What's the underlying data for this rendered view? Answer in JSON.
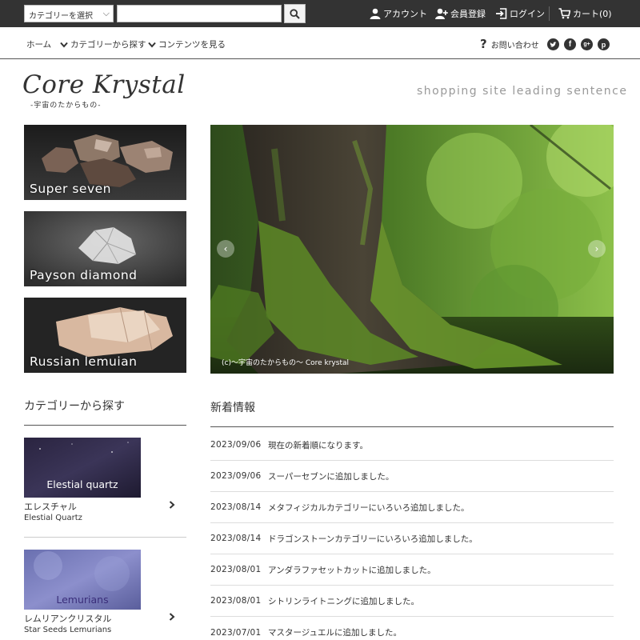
{
  "topbar": {
    "category_select": "カテゴリーを選択",
    "search_placeholder": "",
    "account": "アカウント",
    "register": "会員登録",
    "login": "ログイン",
    "cart": "カート(0)"
  },
  "nav": {
    "home": "ホーム",
    "category": "カテゴリーから探す",
    "contents": "コンテンツを見る",
    "contact": "お問い合わせ"
  },
  "social": [
    "twitter-icon",
    "facebook-icon",
    "google-plus-icon",
    "pinterest-icon"
  ],
  "header": {
    "logo": "Core Krystal",
    "logo_sub": "-宇宙のたからもの-",
    "tagline": "shopping site leading sentence"
  },
  "banners": [
    {
      "label": "Super seven"
    },
    {
      "label": "Payson diamond"
    },
    {
      "label": "Russian lemuian"
    }
  ],
  "slider": {
    "caption": "(c)〜宇宙のたからもの〜 Core krystal"
  },
  "categories": {
    "title": "カテゴリーから探す",
    "items": [
      {
        "image_label": "Elestial quartz",
        "name_jp": "エレスチャル",
        "name_en": "Elestial Quartz"
      },
      {
        "image_label": "Lemurians",
        "name_jp": "レムリアンクリスタル",
        "name_en": "Star Seeds Lemurians"
      }
    ]
  },
  "news": {
    "title": "新着情報",
    "items": [
      {
        "date": "2023/09/06",
        "text": "現在の新着順になります。"
      },
      {
        "date": "2023/09/06",
        "text": "スーパーセブンに追加しました。"
      },
      {
        "date": "2023/08/14",
        "text": "メタフィジカルカテゴリーにいろいろ追加しました。"
      },
      {
        "date": "2023/08/14",
        "text": "ドラゴンストーンカテゴリーにいろいろ追加しました。"
      },
      {
        "date": "2023/08/01",
        "text": "アンダラファセットカットに追加しました。"
      },
      {
        "date": "2023/08/01",
        "text": "シトリンライトニングに追加しました。"
      },
      {
        "date": "2023/07/01",
        "text": "マスタージュエルに追加しました。"
      }
    ]
  },
  "colors": {
    "topbar": "#333333",
    "text": "#333333",
    "tagline": "#999999"
  }
}
